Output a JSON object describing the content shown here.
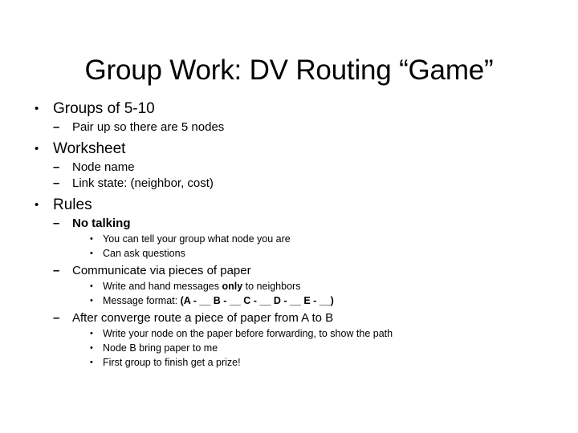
{
  "slide": {
    "title": "Group Work: DV Routing “Game”",
    "background_color": "#FFFFFF",
    "text_color": "#000000",
    "bullets": {
      "level1_glyph": "•",
      "level2_glyph": "–",
      "level3_glyph": "•"
    },
    "outline": [
      {
        "level": 1,
        "text": "Groups of 5-10",
        "children": [
          {
            "level": 2,
            "text": "Pair up so there are 5 nodes",
            "bold": false
          }
        ]
      },
      {
        "level": 1,
        "text": "Worksheet",
        "children": [
          {
            "level": 2,
            "text": "Node name",
            "bold": false
          },
          {
            "level": 2,
            "text": "Link state: (neighbor, cost)",
            "bold": false
          }
        ]
      },
      {
        "level": 1,
        "text": "Rules",
        "children": [
          {
            "level": 2,
            "text": "No talking",
            "bold": true,
            "children": [
              {
                "level": 3,
                "text": "You can tell your group what node you are"
              },
              {
                "level": 3,
                "text": "Can ask questions"
              }
            ]
          },
          {
            "level": 2,
            "text": "Communicate via pieces of paper",
            "bold": false,
            "children": [
              {
                "level": 3,
                "text_parts": [
                  {
                    "text": "Write and hand messages ",
                    "bold": false
                  },
                  {
                    "text": "only",
                    "bold": true
                  },
                  {
                    "text": " to neighbors",
                    "bold": false
                  }
                ],
                "text": "Write and hand messages only to neighbors"
              },
              {
                "level": 3,
                "text_parts": [
                  {
                    "text": "Message format: ",
                    "bold": false
                  },
                  {
                    "text": "(A - __ B - __ C - __ D - __ E - __)",
                    "bold": true
                  }
                ],
                "text": "Message format: (A - __ B - __ C - __ D - __ E - __)"
              }
            ]
          },
          {
            "level": 2,
            "text": "After converge route a piece of paper from A to B",
            "bold": false,
            "children": [
              {
                "level": 3,
                "text": "Write your node on the paper before forwarding, to show the path"
              },
              {
                "level": 3,
                "text": "Node B bring paper to me"
              },
              {
                "level": 3,
                "text": "First group to finish get a prize!"
              }
            ]
          }
        ]
      }
    ]
  }
}
